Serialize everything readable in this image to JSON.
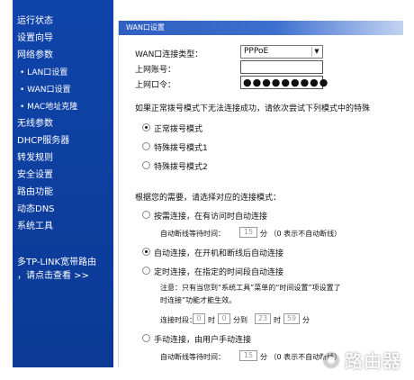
{
  "sidebar": {
    "items": [
      {
        "label": "运行状态"
      },
      {
        "label": "设置向导"
      },
      {
        "label": "网络参数"
      },
      {
        "label": "• LAN口设置"
      },
      {
        "label": "• WAN口设置"
      },
      {
        "label": "• MAC地址克隆"
      },
      {
        "label": "无线参数"
      },
      {
        "label": "DHCP服务器"
      },
      {
        "label": "转发规则"
      },
      {
        "label": "安全设置"
      },
      {
        "label": "路由功能"
      },
      {
        "label": "动态DNS"
      },
      {
        "label": "系统工具"
      }
    ],
    "promo_line1": "多TP-LINK宽带路由",
    "promo_line2": "，请点击查看 >>"
  },
  "panel": {
    "title": "WAN口设置",
    "conn_type_label": "WAN口连接类型：",
    "conn_type_value": "PPPoE",
    "account_label": "上网账号：",
    "account_value": "",
    "password_label": "上网口令：",
    "password_value": "●●●●●●●●●",
    "hint_line": "如果正常拨号模式下无法连接成功，请依次尝试下列模式中的特殊",
    "dial_modes": [
      {
        "label": "正常拨号模式",
        "checked": true
      },
      {
        "label": "特殊拨号模式1",
        "checked": false
      },
      {
        "label": "特殊拨号模式2",
        "checked": false
      }
    ],
    "choose_mode_label": "根据您的需要，请选择对应的连接模式：",
    "on_demand_label": "按需连接，在有访问时自动连接",
    "on_demand_idle_prefix": "自动断线等待时间：",
    "on_demand_idle_value": "15",
    "on_demand_idle_suffix": "分 （0 表示不自动断线）",
    "auto_label": "自动连接，在开机和断线后自动连接",
    "timed_label": "定时连接，在指定的时间段自动连接",
    "note_line1": "注意：只有当您到“系统工具”菜单的“时间设置”项设置了",
    "note_line2": "时连接”功能才能生效。",
    "period_prefix": "连接时段：从",
    "period_from_h": "0",
    "period_h_unit": "时",
    "period_from_m": "0",
    "period_m_unit_to": "分到",
    "period_to_h": "23",
    "period_h_unit2": "时",
    "period_to_m": "59",
    "period_m_unit": "分",
    "manual_label": "手动连接，由用户手动连接",
    "manual_idle_prefix": "自动断线等待时间：",
    "manual_idle_value": "15",
    "manual_idle_suffix": "分 （0 表示不自动断线）",
    "connection_mode_selected": "auto"
  },
  "watermark": {
    "text": "路由器"
  },
  "colors": {
    "sidebar": "#0d3f9e",
    "header": "#2f5fc0"
  }
}
